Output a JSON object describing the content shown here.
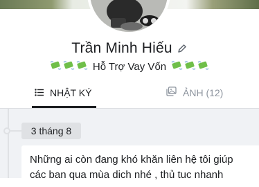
{
  "profile": {
    "name": "Trần Minh Hiếu",
    "bio": "Hỗ Trợ Vay Vốn",
    "bio_emoji_icon": "money-with-wings-icon"
  },
  "tabs": [
    {
      "label": "NHẬT KÝ",
      "icon": "list-icon",
      "active": true
    },
    {
      "label": "ẢNH (12)",
      "icon": "photo-album-icon",
      "active": false
    }
  ],
  "timeline": {
    "date": "3 tháng 8",
    "post_text": "Những ai còn đang khó khăn liên hệ tôi giúp\ncác ban qua mùa dich nhé , thủ tuc nhanh"
  },
  "colors": {
    "feed_background": "#f0f2f5",
    "inactive_tab": "#8d949e",
    "money_green": "#6fbf4a"
  }
}
